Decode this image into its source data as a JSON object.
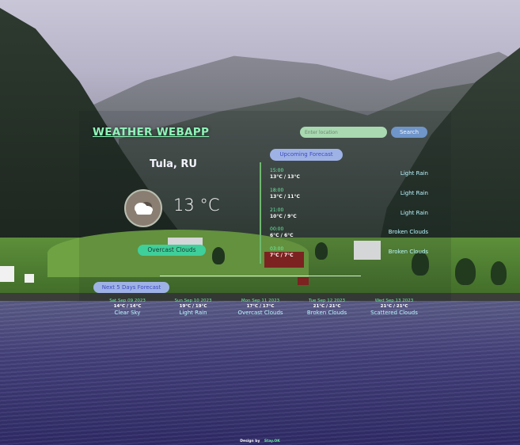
{
  "app": {
    "title": "WEATHER WEBAPP"
  },
  "search": {
    "placeholder": "Enter location",
    "button_label": "Search"
  },
  "current": {
    "city": "Tula, RU",
    "temperature": "13 °C",
    "condition": "Overcast Clouds",
    "icon": "cloud-icon"
  },
  "hourly": {
    "title": "Upcoming Forecast",
    "items": [
      {
        "time": "15:00",
        "temp": "13°C / 13°C",
        "condition": "Light Rain"
      },
      {
        "time": "18:00",
        "temp": "13°C / 11°C",
        "condition": "Light Rain"
      },
      {
        "time": "21:00",
        "temp": "10°C / 9°C",
        "condition": "Light Rain"
      },
      {
        "time": "00:00",
        "temp": "6°C / 6°C",
        "condition": "Broken Clouds"
      },
      {
        "time": "03:00",
        "temp": "7°C / 7°C",
        "condition": "Broken Clouds"
      }
    ]
  },
  "daily": {
    "title": "Next 5 Days Forecast",
    "items": [
      {
        "date": "Sat Sep 09 2023",
        "temp": "14°C / 14°C",
        "condition": "Clear Sky"
      },
      {
        "date": "Sun Sep 10 2023",
        "temp": "19°C / 19°C",
        "condition": "Light Rain"
      },
      {
        "date": "Mon Sep 11 2023",
        "temp": "17°C / 17°C",
        "condition": "Overcast Clouds"
      },
      {
        "date": "Tue Sep 12 2023",
        "temp": "21°C / 21°C",
        "condition": "Broken Clouds"
      },
      {
        "date": "Wed Sep 13 2023",
        "temp": "21°C / 21°C",
        "condition": "Scattered Clouds"
      }
    ]
  },
  "footer": {
    "label": "Design by",
    "author": "Stay.OK"
  },
  "colors": {
    "accent_green": "#6df0a5",
    "pill_blue": "#9fb2e6",
    "condition_pill": "#3fcf9a",
    "search_button": "#6f95c9"
  }
}
